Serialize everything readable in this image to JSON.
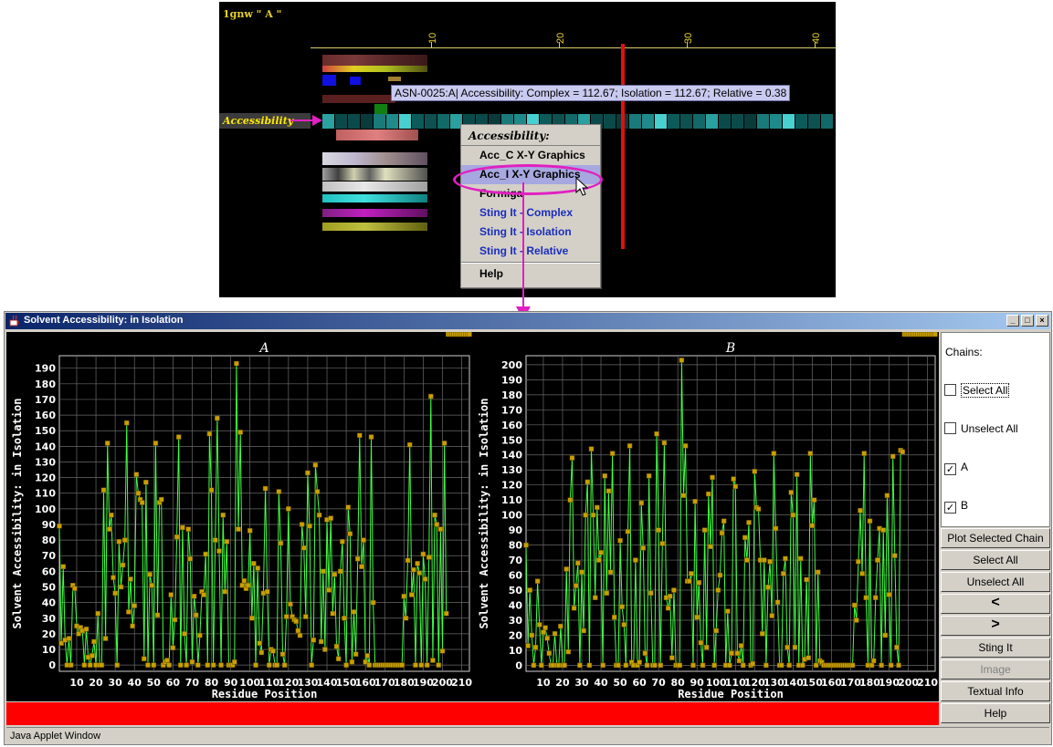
{
  "sequence_view": {
    "title": "1gnw \" A \"",
    "ruler_ticks": [
      "10",
      "20",
      "30",
      "40"
    ],
    "track_label": "Accessibility",
    "tooltip": "ASN-0025:A| Accessibility: Complex = 112.67; Isolation = 112.67; Relative = 0.38",
    "context_menu": {
      "header": "Accessibility:",
      "items": [
        {
          "label": "Acc_C X-Y Graphics",
          "style": "black"
        },
        {
          "label": "Acc_I X-Y Graphics",
          "style": "black",
          "selected": true
        },
        {
          "label": "Formiga",
          "style": "black"
        },
        {
          "label": "Sting It - Complex",
          "style": "blue"
        },
        {
          "label": "Sting It - Isolation",
          "style": "blue"
        },
        {
          "label": "Sting It - Relative",
          "style": "blue"
        },
        {
          "label": "Help",
          "style": "black"
        }
      ]
    },
    "colors": {
      "accent": "#e020c0",
      "marker": "#e01010",
      "ruler": "#e6d12b"
    }
  },
  "window": {
    "title": "Solvent Accessibility: in Isolation",
    "status": "Java Applet Window",
    "controls": {
      "minimize": "_",
      "maximize": "□",
      "close": "×"
    },
    "chains_panel": {
      "title": "Chains:",
      "options": [
        {
          "label": "Select All",
          "checked": false
        },
        {
          "label": "Unselect All",
          "checked": false
        },
        {
          "label": "A",
          "checked": true
        },
        {
          "label": "B",
          "checked": true
        }
      ]
    },
    "buttons": [
      {
        "label": "Plot Selected Chain",
        "enabled": true
      },
      {
        "label": "Select All",
        "enabled": true
      },
      {
        "label": "Unselect All",
        "enabled": true
      },
      {
        "label": "<",
        "enabled": true
      },
      {
        "label": ">",
        "enabled": true
      },
      {
        "label": "Sting It",
        "enabled": true
      },
      {
        "label": "Image",
        "enabled": false
      },
      {
        "label": "Textual Info",
        "enabled": true
      },
      {
        "label": "Help",
        "enabled": true
      }
    ]
  },
  "chart_data": [
    {
      "type": "line",
      "title": "A",
      "xlabel": "Residue Position",
      "ylabel": "Solvent Accessibility: in Isolation",
      "xlim": [
        1,
        214
      ],
      "ylim": [
        -4,
        198
      ],
      "yticks": [
        0,
        10,
        20,
        30,
        40,
        50,
        60,
        70,
        80,
        90,
        100,
        110,
        120,
        130,
        140,
        150,
        160,
        170,
        180,
        190
      ],
      "xticks": [
        10,
        20,
        30,
        40,
        50,
        60,
        70,
        80,
        90,
        100,
        110,
        120,
        130,
        140,
        150,
        160,
        170,
        180,
        190,
        200,
        210
      ],
      "grid": true,
      "line_color": "#40ff40",
      "marker_color": "#c8a000",
      "x": [
        1,
        2,
        3,
        4,
        5,
        6,
        7,
        8,
        9,
        10,
        11,
        12,
        13,
        14,
        15,
        16,
        17,
        18,
        19,
        20,
        21,
        22,
        23,
        24,
        25,
        26,
        27,
        28,
        29,
        30,
        31,
        32,
        33,
        34,
        35,
        36,
        37,
        38,
        39,
        40,
        41,
        42,
        43,
        44,
        45,
        46,
        47,
        48,
        49,
        50,
        51,
        52,
        53,
        54,
        55,
        56,
        57,
        58,
        59,
        60,
        61,
        62,
        63,
        64,
        65,
        66,
        67,
        68,
        69,
        70,
        71,
        72,
        73,
        74,
        75,
        76,
        77,
        78,
        79,
        80,
        81,
        82,
        83,
        84,
        85,
        86,
        87,
        88,
        89,
        90,
        91,
        92,
        93,
        94,
        95,
        96,
        97,
        98,
        99,
        100,
        101,
        102,
        103,
        104,
        105,
        106,
        107,
        108,
        109,
        110,
        111,
        112,
        113,
        114,
        115,
        116,
        117,
        118,
        119,
        120,
        121,
        122,
        123,
        124,
        125,
        126,
        127,
        128,
        129,
        130,
        131,
        132,
        133,
        134,
        135,
        136,
        137,
        138,
        139,
        140,
        141,
        142,
        143,
        144,
        145,
        146,
        147,
        148,
        149,
        150,
        151,
        152,
        153,
        154,
        155,
        156,
        157,
        158,
        159,
        160,
        161,
        162,
        163,
        164,
        165,
        166,
        167,
        168,
        169,
        170,
        171,
        172,
        173,
        174,
        175,
        176,
        177,
        178,
        179,
        180,
        181,
        182,
        183,
        184,
        185,
        186,
        187,
        188,
        189,
        190,
        191,
        192,
        193,
        194,
        195,
        196,
        197,
        198,
        199,
        200,
        201,
        202,
        203,
        204,
        205,
        206,
        207,
        208,
        209,
        210,
        211,
        212,
        213,
        214
      ],
      "values": [
        89,
        14,
        63,
        16,
        0,
        17,
        0,
        51,
        49,
        25,
        20,
        24,
        22,
        0,
        23,
        5,
        0,
        6,
        15,
        0,
        33,
        0,
        0,
        112,
        17,
        142,
        87,
        96,
        56,
        46,
        0,
        79,
        50,
        64,
        80,
        155,
        34,
        55,
        25,
        38,
        122,
        110,
        106,
        104,
        4,
        117,
        0,
        58,
        51,
        0,
        142,
        32,
        104,
        106,
        0,
        2,
        3,
        0,
        45,
        11,
        29,
        82,
        146,
        0,
        88,
        20,
        0,
        87,
        68,
        2,
        44,
        32,
        0,
        19,
        47,
        45,
        71,
        0,
        148,
        112,
        0,
        80,
        158,
        73,
        0,
        96,
        47,
        79,
        0,
        0,
        0,
        2,
        193,
        87,
        149,
        51,
        54,
        49,
        51,
        86,
        30,
        65,
        0,
        62,
        14,
        8,
        46,
        113,
        47,
        0,
        10,
        9,
        0,
        0,
        111,
        78,
        7,
        0,
        31,
        100,
        39,
        31,
        29,
        28,
        22,
        19,
        90,
        75,
        31,
        123,
        89,
        0,
        16,
        128,
        111,
        96,
        15,
        60,
        10,
        93,
        48,
        94,
        33,
        58,
        12,
        4,
        60,
        79,
        30,
        0,
        101,
        84,
        2,
        34,
        7,
        68,
        147,
        63,
        80,
        2,
        6,
        0,
        146,
        40,
        0,
        0,
        0,
        0,
        0,
        0,
        0,
        0,
        0,
        0,
        0,
        0,
        0,
        0,
        0,
        44,
        30,
        67,
        141,
        45,
        61,
        0,
        65,
        59,
        0,
        71,
        55,
        0,
        69,
        172,
        3,
        96,
        90,
        0,
        87,
        9,
        142,
        33
      ]
    },
    {
      "type": "line",
      "title": "B",
      "xlabel": "Residue Position",
      "ylabel": "Solvent Accessibility: in Isolation",
      "xlim": [
        1,
        214
      ],
      "ylim": [
        -4,
        206
      ],
      "yticks": [
        0,
        10,
        20,
        30,
        40,
        50,
        60,
        70,
        80,
        90,
        100,
        110,
        120,
        130,
        140,
        150,
        160,
        170,
        180,
        190,
        200
      ],
      "xticks": [
        10,
        20,
        30,
        40,
        50,
        60,
        70,
        80,
        90,
        100,
        110,
        120,
        130,
        140,
        150,
        160,
        170,
        180,
        190,
        200,
        210
      ],
      "grid": true,
      "line_color": "#40ff40",
      "marker_color": "#c8a000",
      "x": [
        1,
        2,
        3,
        4,
        5,
        6,
        7,
        8,
        9,
        10,
        11,
        12,
        13,
        14,
        15,
        16,
        17,
        18,
        19,
        20,
        21,
        22,
        23,
        24,
        25,
        26,
        27,
        28,
        29,
        30,
        31,
        32,
        33,
        34,
        35,
        36,
        37,
        38,
        39,
        40,
        41,
        42,
        43,
        44,
        45,
        46,
        47,
        48,
        49,
        50,
        51,
        52,
        53,
        54,
        55,
        56,
        57,
        58,
        59,
        60,
        61,
        62,
        63,
        64,
        65,
        66,
        67,
        68,
        69,
        70,
        71,
        72,
        73,
        74,
        75,
        76,
        77,
        78,
        79,
        80,
        81,
        82,
        83,
        84,
        85,
        86,
        87,
        88,
        89,
        90,
        91,
        92,
        93,
        94,
        95,
        96,
        97,
        98,
        99,
        100,
        101,
        102,
        103,
        104,
        105,
        106,
        107,
        108,
        109,
        110,
        111,
        112,
        113,
        114,
        115,
        116,
        117,
        118,
        119,
        120,
        121,
        122,
        123,
        124,
        125,
        126,
        127,
        128,
        129,
        130,
        131,
        132,
        133,
        134,
        135,
        136,
        137,
        138,
        139,
        140,
        141,
        142,
        143,
        144,
        145,
        146,
        147,
        148,
        149,
        150,
        151,
        152,
        153,
        154,
        155,
        156,
        157,
        158,
        159,
        160,
        161,
        162,
        163,
        164,
        165,
        166,
        167,
        168,
        169,
        170,
        171,
        172,
        173,
        174,
        175,
        176,
        177,
        178,
        179,
        180,
        181,
        182,
        183,
        184,
        185,
        186,
        187,
        188,
        189,
        190,
        191,
        192,
        193,
        194,
        195,
        196,
        197,
        198,
        199,
        200,
        201,
        202,
        203,
        204,
        205,
        206,
        207,
        208,
        209,
        210,
        211,
        212,
        213,
        214
      ],
      "values": [
        80,
        13,
        50,
        20,
        0,
        12,
        56,
        27,
        0,
        22,
        25,
        18,
        8,
        0,
        0,
        21,
        0,
        0,
        26,
        0,
        0,
        64,
        9,
        110,
        138,
        38,
        53,
        68,
        0,
        62,
        23,
        100,
        122,
        0,
        144,
        100,
        45,
        105,
        70,
        75,
        0,
        126,
        48,
        116,
        62,
        141,
        32,
        0,
        0,
        83,
        39,
        27,
        0,
        89,
        146,
        2,
        0,
        70,
        0,
        2,
        108,
        78,
        8,
        0,
        126,
        48,
        0,
        0,
        154,
        90,
        0,
        81,
        148,
        45,
        38,
        46,
        5,
        50,
        0,
        0,
        0,
        203,
        113,
        146,
        56,
        56,
        61,
        0,
        109,
        32,
        55,
        15,
        0,
        90,
        12,
        114,
        79,
        125,
        0,
        23,
        50,
        60,
        88,
        96,
        0,
        36,
        0,
        8,
        124,
        119,
        8,
        3,
        13,
        0,
        85,
        70,
        95,
        0,
        1,
        129,
        105,
        104,
        70,
        21,
        70,
        0,
        52,
        69,
        33,
        141,
        91,
        42,
        0,
        0,
        61,
        71,
        12,
        0,
        115,
        100,
        12,
        127,
        0,
        71,
        0,
        4,
        57,
        5,
        141,
        93,
        110,
        0,
        62,
        3,
        2,
        0,
        0,
        0,
        0,
        0,
        0,
        0,
        0,
        0,
        0,
        0,
        0,
        0,
        0,
        0,
        0,
        40,
        30,
        69,
        103,
        61,
        141,
        45,
        0,
        96,
        0,
        3,
        45,
        70,
        91,
        0,
        90,
        20,
        113,
        47,
        0,
        139,
        73,
        12,
        0,
        143,
        142
      ]
    }
  ]
}
